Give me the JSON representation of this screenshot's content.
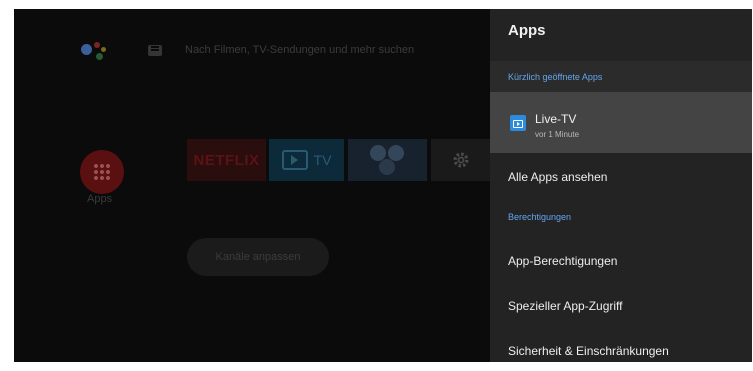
{
  "home": {
    "search_placeholder": "Nach Filmen, TV-Sendungen und mehr suchen",
    "apps_label": "Apps",
    "channels_button": "Kanäle anpassen",
    "cards": {
      "netflix": "NETFLIX",
      "tv": "TV"
    }
  },
  "panel": {
    "title": "Apps",
    "section_recent": "Kürzlich geöffnete Apps",
    "recent_app": {
      "name": "Live-TV",
      "subtitle": "vor 1 Minute",
      "icon": "live-tv-icon"
    },
    "all_apps": "Alle Apps ansehen",
    "section_permissions": "Berechtigungen",
    "app_permissions": "App-Berechtigungen",
    "special_access": "Spezieller App-Zugriff",
    "security": "Sicherheit & Einschränkungen"
  },
  "colors": {
    "accent": "#64a5ee",
    "panel_bg": "#232323",
    "selected_bg": "#444444",
    "live_tv_icon": "#2b8bdc"
  }
}
